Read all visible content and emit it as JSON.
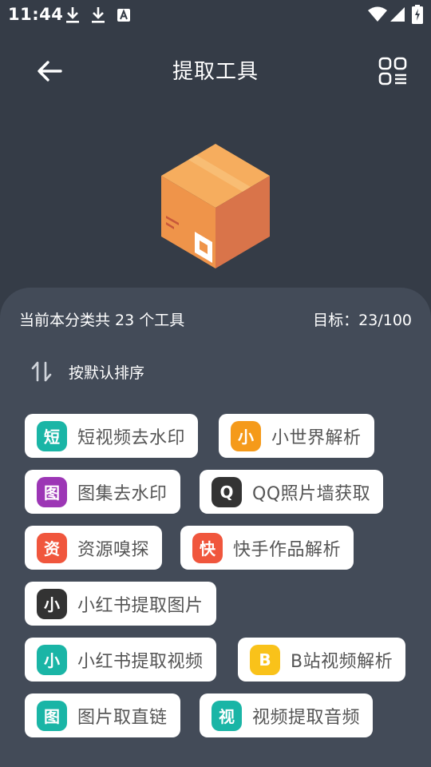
{
  "status_bar": {
    "time": "11:44"
  },
  "header": {
    "title": "提取工具"
  },
  "summary": {
    "count_text": "当前本分类共 23 个工具",
    "target_text": "目标：23/100"
  },
  "sort": {
    "label": "按默认排序"
  },
  "tools": [
    {
      "badge": "短",
      "label": "短视频去水印",
      "color": "#1ab5a6"
    },
    {
      "badge": "小",
      "label": "小世界解析",
      "color": "#f59a1a"
    },
    {
      "badge": "图",
      "label": "图集去水印",
      "color": "#9c36b5"
    },
    {
      "badge": "Q",
      "label": "QQ照片墙获取",
      "color": "#333333"
    },
    {
      "badge": "资",
      "label": "资源嗅探",
      "color": "#f0563d"
    },
    {
      "badge": "快",
      "label": "快手作品解析",
      "color": "#f0563d"
    },
    {
      "badge": "小",
      "label": "小红书提取图片",
      "color": "#333333"
    },
    {
      "badge": "小",
      "label": "小红书提取视频",
      "color": "#1ab5a6"
    },
    {
      "badge": "B",
      "label": "B站视频解析",
      "color": "#f9c21a"
    },
    {
      "badge": "图",
      "label": "图片取直链",
      "color": "#1ab5a6"
    },
    {
      "badge": "视",
      "label": "视频提取音频",
      "color": "#1ab5a6"
    }
  ]
}
